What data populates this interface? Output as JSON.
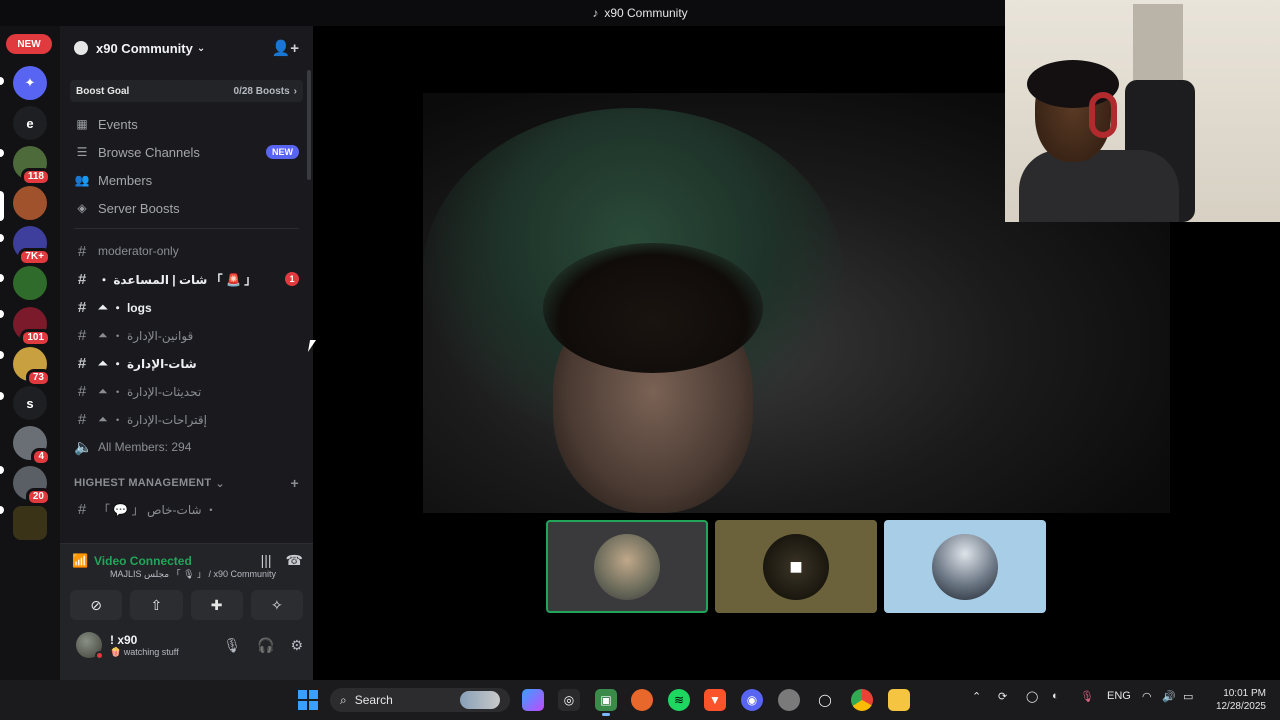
{
  "window": {
    "title": "x90 Community"
  },
  "rail": {
    "new_label": "NEW",
    "servers": [
      {
        "label": "",
        "badge": "",
        "color": "#5865f2",
        "icon": "discord-icon"
      },
      {
        "label": "e",
        "badge": "",
        "color": "#1e1f22"
      },
      {
        "label": "",
        "badge": "118",
        "color": "#4d6a3a"
      },
      {
        "label": "",
        "badge": "",
        "color": "#a0522d"
      },
      {
        "label": "",
        "badge": "7K+",
        "color": "#3e3f9c"
      },
      {
        "label": "",
        "badge": "",
        "color": "#2f6b2a"
      },
      {
        "label": "",
        "badge": "101",
        "color": "#7a1a2a"
      },
      {
        "label": "",
        "badge": "73",
        "color": "#c8a040"
      },
      {
        "label": "s",
        "badge": "",
        "color": "#1e1f22"
      },
      {
        "label": "",
        "badge": "4",
        "color": "#6a6f76"
      },
      {
        "label": "",
        "badge": "20",
        "color": "#5a5f66"
      },
      {
        "label": "",
        "badge": "",
        "color": "#3a3318"
      }
    ]
  },
  "sidebar": {
    "server_name": "x90 Community",
    "boost": {
      "label": "Boost Goal",
      "count": "0/28 Boosts"
    },
    "nav": [
      {
        "label": "Events",
        "icon": "calendar-icon"
      },
      {
        "label": "Browse Channels",
        "icon": "browse-icon",
        "badge": "NEW"
      },
      {
        "label": "Members",
        "icon": "members-icon"
      },
      {
        "label": "Server Boosts",
        "icon": "boost-icon"
      }
    ],
    "channels": [
      {
        "label": "moderator-only",
        "bright": false,
        "unread": false,
        "mention": ""
      },
      {
        "label": "・ شات | المساعدة 「 🚨 」",
        "bright": true,
        "unread": true,
        "mention": "1"
      },
      {
        "label": "・ logs",
        "bright": true,
        "unread": true,
        "mention": ""
      },
      {
        "label": "・ قوانين-الإدارة",
        "bright": false,
        "unread": false,
        "mention": ""
      },
      {
        "label": "・ شات-الإدارة",
        "bright": true,
        "unread": true,
        "mention": ""
      },
      {
        "label": "・ تحديثات-الإدارة",
        "bright": false,
        "unread": false,
        "mention": ""
      },
      {
        "label": "・ إقتراحات-الإدارة",
        "bright": false,
        "unread": false,
        "mention": ""
      },
      {
        "label": "All Members: 294",
        "bright": false,
        "unread": false,
        "mention": "",
        "voice": true
      }
    ],
    "category": "HIGHEST MANAGEMENT",
    "category_channel": "「 💬 」 شات-خاص ・"
  },
  "voice_panel": {
    "status": "Video Connected",
    "channel": "MAJLIS مجلس 「 🎙 」 / x90 Community",
    "user_name": "! x90",
    "user_status": "🍿 watching stuff"
  },
  "taskbar": {
    "search_label": "Search",
    "language": "ENG",
    "time": "10:01 PM",
    "date": "12/28/2025"
  }
}
